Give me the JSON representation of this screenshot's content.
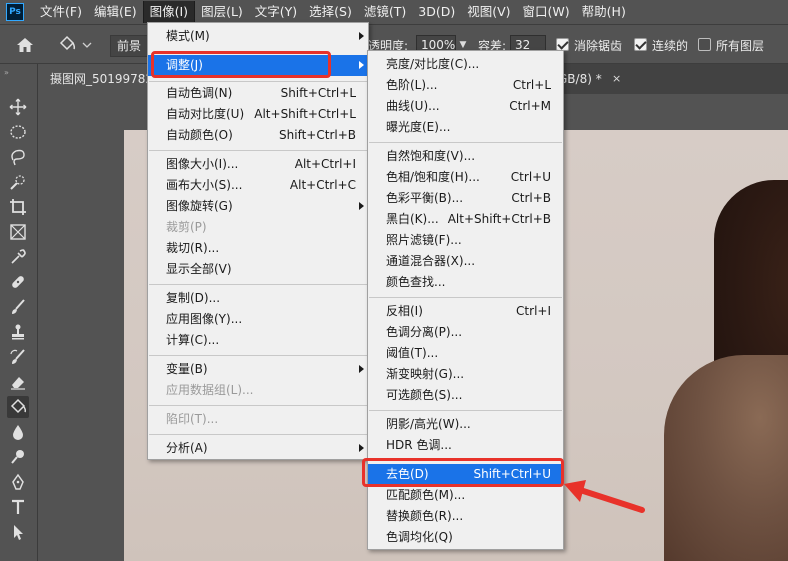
{
  "app": {
    "logo": "Ps"
  },
  "menubar": {
    "items": [
      "文件(F)",
      "编辑(E)",
      "图像(I)",
      "图层(L)",
      "文字(Y)",
      "选择(S)",
      "滤镜(T)",
      "3D(D)",
      "视图(V)",
      "窗口(W)",
      "帮助(H)"
    ],
    "active": "图像(I)"
  },
  "options": {
    "preset_label": "前景",
    "opacity_label": "透明度:",
    "opacity_value": "100%",
    "tolerance_label": "容差:",
    "tolerance_value": "32",
    "antialias_label": "消除锯齿",
    "contiguous_label": "连续的",
    "all_layers_label": "所有图层"
  },
  "tabs": {
    "doc1": "摄图网_50199782",
    "doc2": "GB/8) *",
    "close": "×"
  },
  "image_menu": {
    "items": [
      {
        "label": "模式(M)",
        "arrow": true
      },
      {
        "label": "调整(J)",
        "arrow": true,
        "highlight": true
      },
      {
        "label": "自动色调(N)",
        "shortcut": "Shift+Ctrl+L"
      },
      {
        "label": "自动对比度(U)",
        "shortcut": "Alt+Shift+Ctrl+L"
      },
      {
        "label": "自动颜色(O)",
        "shortcut": "Shift+Ctrl+B"
      },
      {
        "label": "图像大小(I)...",
        "shortcut": "Alt+Ctrl+I"
      },
      {
        "label": "画布大小(S)...",
        "shortcut": "Alt+Ctrl+C"
      },
      {
        "label": "图像旋转(G)",
        "arrow": true
      },
      {
        "label": "裁剪(P)",
        "disabled": true
      },
      {
        "label": "裁切(R)..."
      },
      {
        "label": "显示全部(V)"
      },
      {
        "label": "复制(D)..."
      },
      {
        "label": "应用图像(Y)..."
      },
      {
        "label": "计算(C)..."
      },
      {
        "label": "变量(B)",
        "arrow": true
      },
      {
        "label": "应用数据组(L)...",
        "disabled": true
      },
      {
        "label": "陷印(T)...",
        "disabled": true
      },
      {
        "label": "分析(A)",
        "arrow": true
      }
    ]
  },
  "adjust_menu": {
    "items": [
      {
        "label": "亮度/对比度(C)..."
      },
      {
        "label": "色阶(L)...",
        "shortcut": "Ctrl+L"
      },
      {
        "label": "曲线(U)...",
        "shortcut": "Ctrl+M"
      },
      {
        "label": "曝光度(E)..."
      },
      {
        "label": "自然饱和度(V)..."
      },
      {
        "label": "色相/饱和度(H)...",
        "shortcut": "Ctrl+U"
      },
      {
        "label": "色彩平衡(B)...",
        "shortcut": "Ctrl+B"
      },
      {
        "label": "黑白(K)...",
        "shortcut": "Alt+Shift+Ctrl+B"
      },
      {
        "label": "照片滤镜(F)..."
      },
      {
        "label": "通道混合器(X)..."
      },
      {
        "label": "颜色查找..."
      },
      {
        "label": "反相(I)",
        "shortcut": "Ctrl+I"
      },
      {
        "label": "色调分离(P)..."
      },
      {
        "label": "阈值(T)..."
      },
      {
        "label": "渐变映射(G)..."
      },
      {
        "label": "可选颜色(S)..."
      },
      {
        "label": "阴影/高光(W)..."
      },
      {
        "label": "HDR 色调..."
      },
      {
        "label": "去色(D)",
        "shortcut": "Shift+Ctrl+U",
        "highlight": true
      },
      {
        "label": "匹配颜色(M)..."
      },
      {
        "label": "替换颜色(R)..."
      },
      {
        "label": "色调均化(Q)"
      }
    ]
  },
  "colors": {
    "highlight": "#1a73e8",
    "callout": "#e8322a",
    "menu_bg": "#f0f0f0",
    "chrome": "#535353"
  }
}
